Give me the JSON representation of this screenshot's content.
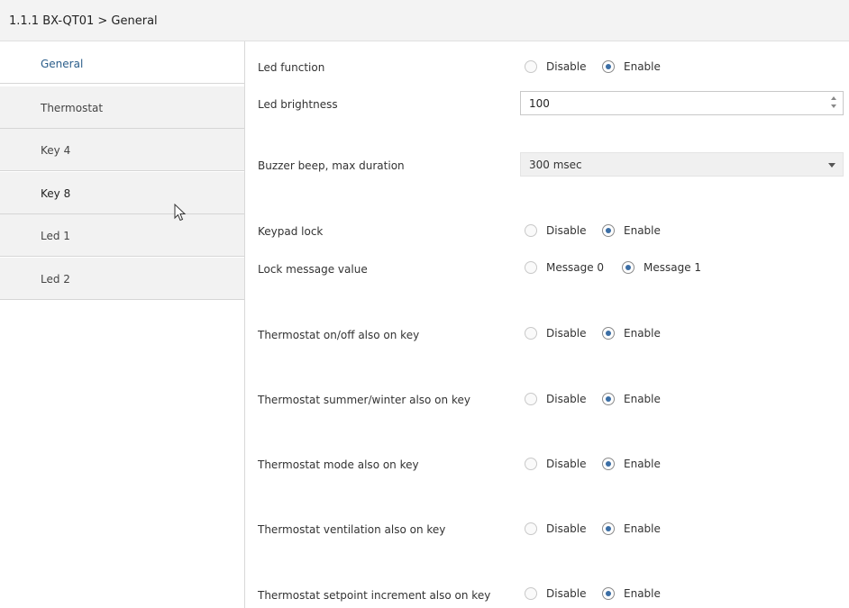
{
  "header": {
    "title": "1.1.1 BX-QT01 > General"
  },
  "sidebar": {
    "items": [
      {
        "label": "General",
        "active": true
      },
      {
        "label": "Thermostat"
      },
      {
        "label": "Key 4"
      },
      {
        "label": "Key 8"
      },
      {
        "label": "Led 1"
      },
      {
        "label": "Led 2"
      }
    ]
  },
  "settings": {
    "led_function": {
      "label": "Led function",
      "options": [
        "Disable",
        "Enable"
      ],
      "selected": "Enable"
    },
    "led_brightness": {
      "label": "Led brightness",
      "value": "100"
    },
    "buzzer": {
      "label": "Buzzer beep, max duration",
      "value": "300 msec"
    },
    "keypad_lock": {
      "label": "Keypad lock",
      "options": [
        "Disable",
        "Enable"
      ],
      "selected": "Enable"
    },
    "lock_message": {
      "label": "Lock message value",
      "options": [
        "Message 0",
        "Message 1"
      ],
      "selected": "Message 1"
    },
    "thermo_onoff": {
      "label": "Thermostat on/off also on key",
      "options": [
        "Disable",
        "Enable"
      ],
      "selected": "Enable"
    },
    "thermo_summer": {
      "label": "Thermostat summer/winter also on key",
      "options": [
        "Disable",
        "Enable"
      ],
      "selected": "Enable"
    },
    "thermo_mode": {
      "label": "Thermostat mode also on key",
      "options": [
        "Disable",
        "Enable"
      ],
      "selected": "Enable"
    },
    "thermo_vent": {
      "label": "Thermostat ventilation also on key",
      "options": [
        "Disable",
        "Enable"
      ],
      "selected": "Enable"
    },
    "thermo_setpoint": {
      "label": "Thermostat setpoint increment also on key",
      "options": [
        "Disable",
        "Enable"
      ],
      "selected": "Enable"
    }
  },
  "colors": {
    "accent": "#3b6ea5",
    "active_nav": "#2a5d8a",
    "sidebar_bg": "#f2f2f2"
  }
}
